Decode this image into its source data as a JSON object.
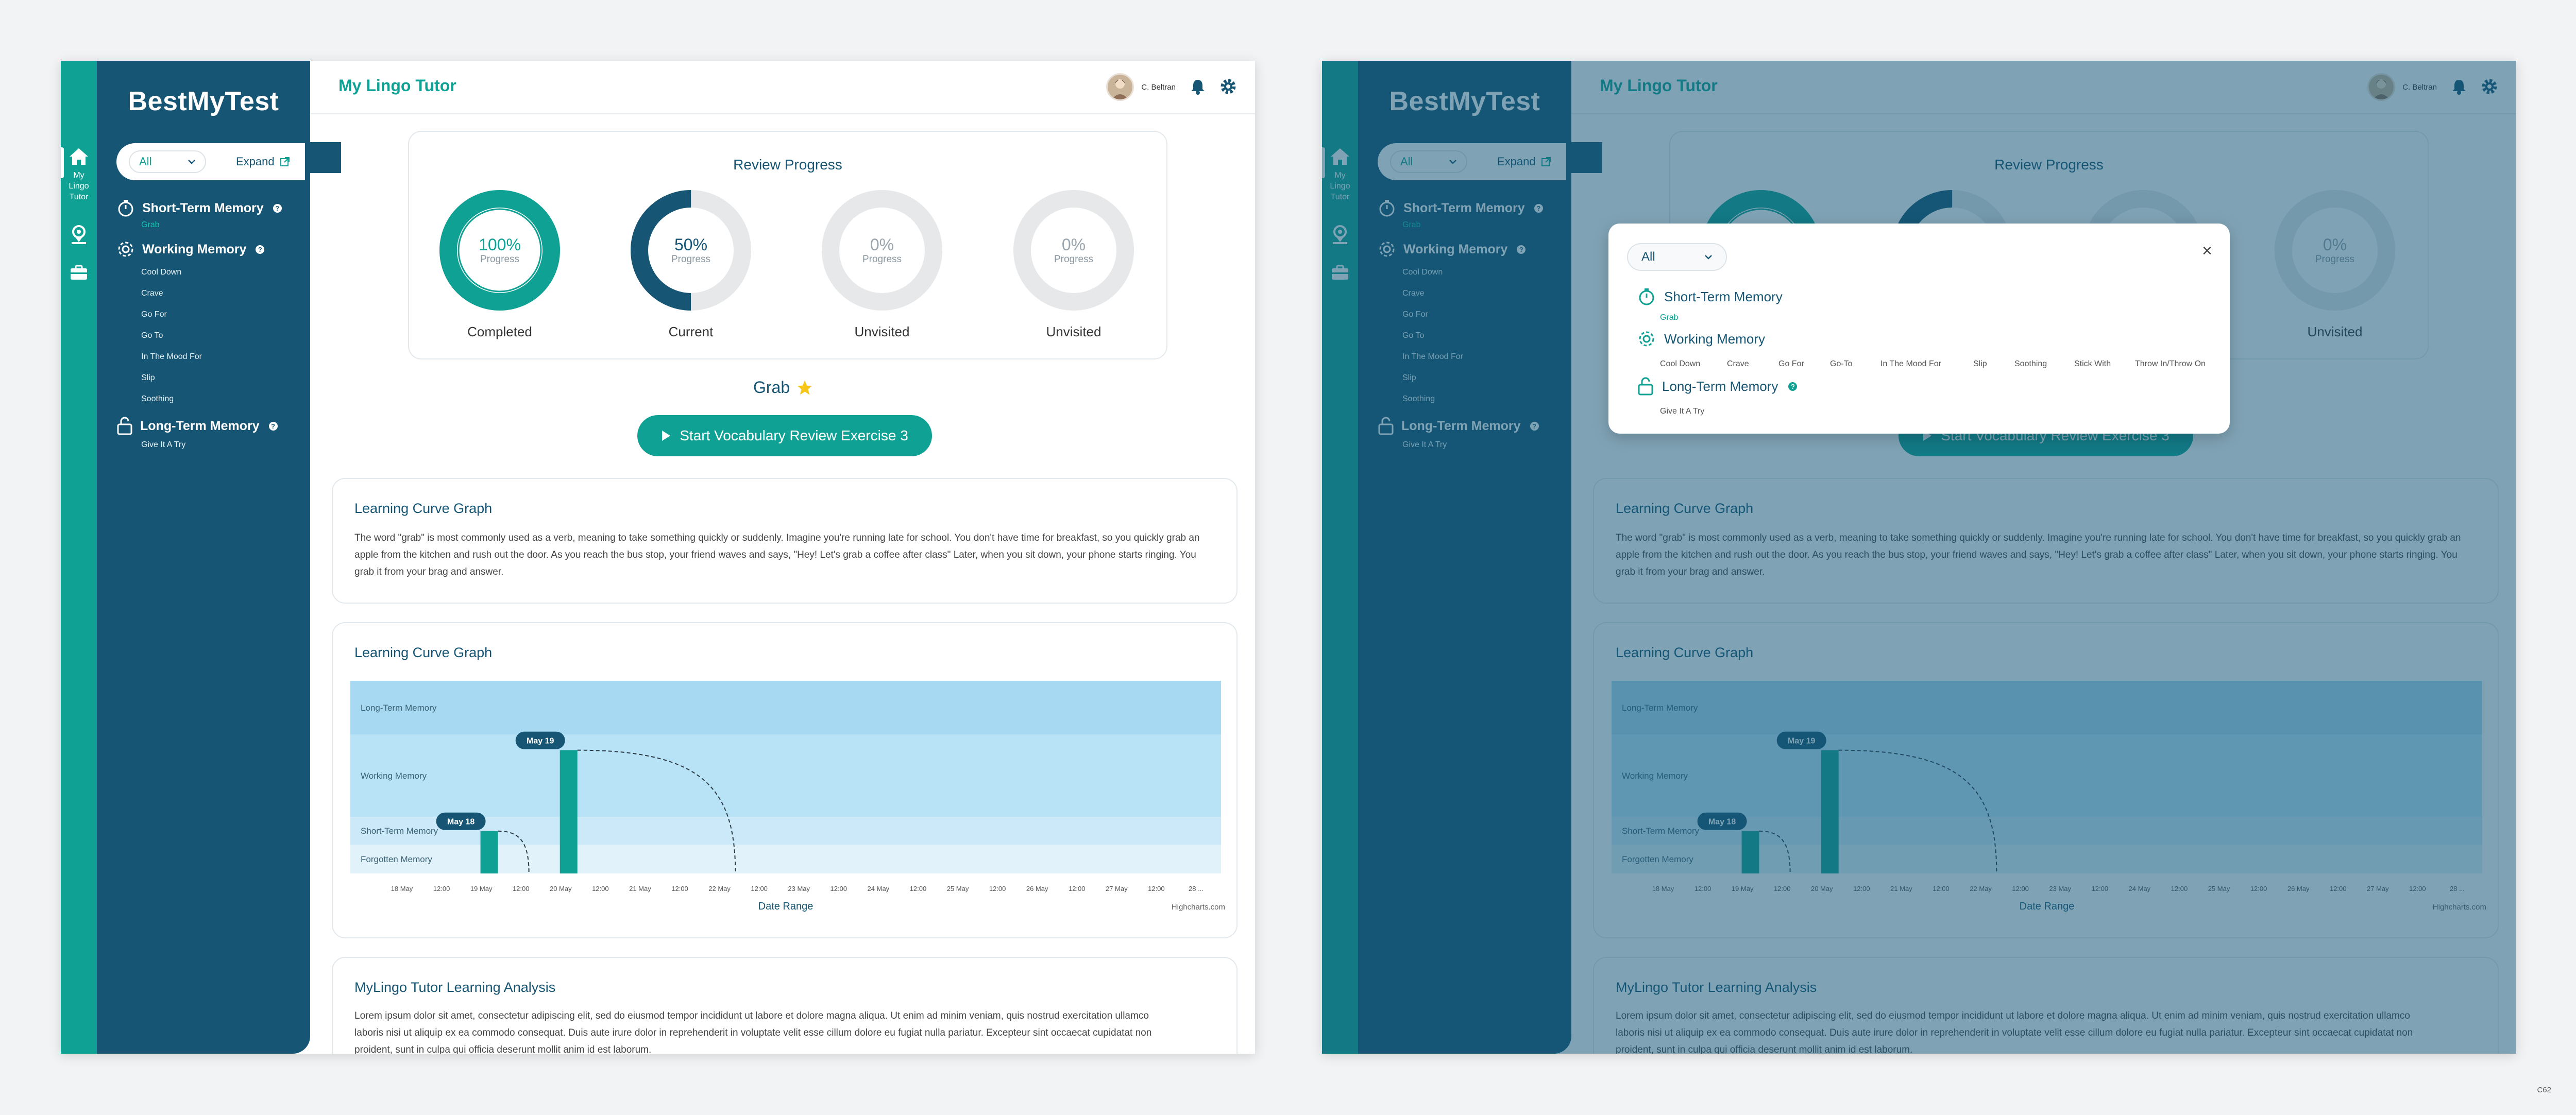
{
  "app": {
    "brand": "BestMyTest",
    "title": "My Lingo Tutor",
    "user_name": "C. Beltran",
    "corner_label": "C62"
  },
  "rail": {
    "items": [
      {
        "id": "home",
        "label": "My Lingo Tutor",
        "icon": "home-icon"
      },
      {
        "id": "map",
        "label": "",
        "icon": "map-pin-icon"
      },
      {
        "id": "briefcase",
        "label": "",
        "icon": "briefcase-icon"
      }
    ]
  },
  "filter": {
    "selected": "All",
    "expand_label": "Expand"
  },
  "tree": {
    "short_term": {
      "label": "Short-Term Memory",
      "items": [
        "Grab"
      ]
    },
    "working": {
      "label": "Working Memory",
      "items": [
        "Cool Down",
        "Crave",
        "Go For",
        "Go To",
        "In The Mood For",
        "Slip",
        "Soothing"
      ]
    },
    "long_term": {
      "label": "Long-Term Memory",
      "items": [
        "Give It A Try"
      ]
    }
  },
  "review": {
    "title": "Review Progress",
    "progress_word": "Progress",
    "donuts": [
      {
        "percent": "100%",
        "value": 1.0,
        "label": "Completed",
        "color": "#0fa294"
      },
      {
        "percent": "50%",
        "value": 0.5,
        "label": "Current",
        "color": "#165674"
      },
      {
        "percent": "0%",
        "value": 0.0,
        "label": "Unvisited",
        "color": "#9aa5ad"
      },
      {
        "percent": "0%",
        "value": 0.0,
        "label": "Unvisited",
        "color": "#9aa5ad"
      }
    ]
  },
  "current_word": "Grab",
  "start_button": "Start Vocabulary Review Exercise 3",
  "curve_text_card": {
    "title": "Learning Curve Graph",
    "text": "The word \"grab\" is most commonly used as a verb, meaning to take something quickly or suddenly. Imagine you're running late for school. You don't have time for breakfast, so you quickly grab an apple from the kitchen and rush out the door. As you reach the bus stop, your friend waves and says, \"Hey! Let's grab a coffee after class\" Later, when you sit down, your phone starts ringing. You grab it from your brag and answer."
  },
  "analysis": {
    "title": "MyLingo Tutor Learning Analysis",
    "text": "Lorem ipsum dolor sit amet, consectetur adipiscing elit, sed do eiusmod tempor incididunt ut labore et dolore magna aliqua. Ut enim ad minim veniam, quis nostrud exercitation ullamco laboris nisi ut aliquip ex ea commodo consequat. Duis aute irure dolor in reprehenderit in voluptate velit esse cillum dolore eu fugiat nulla pariatur. Excepteur sint occaecat cupidatat non proident, sunt in culpa qui officia deserunt mollit anim id est laborum."
  },
  "chart_data": {
    "type": "bar",
    "title": "Learning Curve Graph",
    "xlabel": "Date Range",
    "ylabel": "",
    "credit": "Highcharts.com",
    "bands": [
      "Long-Term Memory",
      "Working Memory",
      "Short-Term Memory",
      "Forgotten Memory"
    ],
    "band_colors": [
      "#a8d9f2",
      "#b8e2f6",
      "#cbe9f8",
      "#e1f2fb"
    ],
    "x_ticks": [
      "18 May",
      "12:00",
      "19 May",
      "12:00",
      "20 May",
      "12:00",
      "21 May",
      "12:00",
      "22 May",
      "12:00",
      "23 May",
      "12:00",
      "24 May",
      "12:00",
      "25 May",
      "12:00",
      "26 May",
      "12:00",
      "27 May",
      "12:00",
      "28 ..."
    ],
    "xlim": [
      0,
      20.5
    ],
    "ylim": [
      0,
      1
    ],
    "series": [
      {
        "label": "May 18",
        "x": 2.2,
        "y": 0.22,
        "decay_end": 3.2
      },
      {
        "label": "May 19",
        "x": 4.2,
        "y": 0.64,
        "decay_end": 8.4
      }
    ],
    "bar_color": "#0fa294",
    "tooltip_color": "#165674"
  },
  "modal": {
    "selected": "All",
    "close_label": "×",
    "short_term": {
      "label": "Short-Term Memory",
      "items": [
        "Grab"
      ]
    },
    "working": {
      "label": "Working Memory",
      "items": [
        "Cool Down",
        "Crave",
        "Go For",
        "Go-To",
        "In The Mood For",
        "Slip",
        "Soothing",
        "Stick With",
        "Throw In/Throw On"
      ]
    },
    "long_term": {
      "label": "Long-Term Memory",
      "items": [
        "Give It A Try"
      ]
    }
  }
}
